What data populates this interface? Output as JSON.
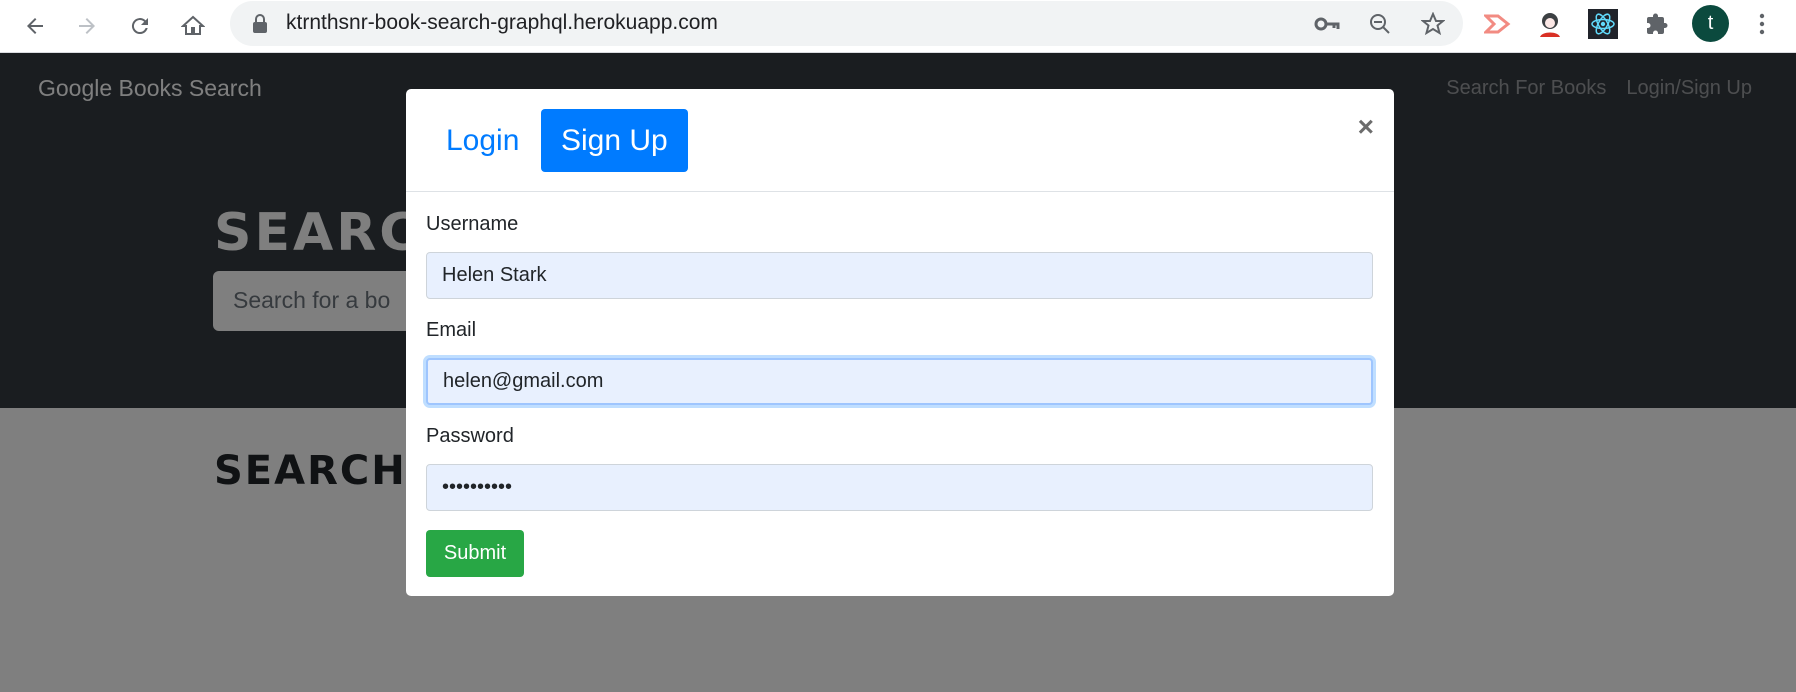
{
  "browser": {
    "url": "ktrnthsnr-book-search-graphql.herokuapp.com",
    "profile_initial": "t",
    "icons": [
      "back-arrow-icon",
      "forward-arrow-icon",
      "reload-icon",
      "home-icon",
      "lock-icon",
      "key-icon",
      "zoom-out-icon",
      "star-icon",
      "extension-arrow-icon",
      "extension-avatar-icon",
      "react-devtools-icon",
      "puzzle-icon",
      "kebab-menu-icon"
    ]
  },
  "navbar": {
    "brand": "Google Books Search",
    "links": [
      "Search For Books",
      "Login/Sign Up"
    ]
  },
  "hero": {
    "title": "SEARC",
    "search_placeholder": "Search for a bo"
  },
  "content": {
    "title": "SEARCH"
  },
  "modal": {
    "tabs": [
      "Login",
      "Sign Up"
    ],
    "active_tab": "Sign Up",
    "close_label": "×",
    "fields": [
      {
        "label": "Username",
        "value": "Helen Stark"
      },
      {
        "label": "Email",
        "value": "helen@gmail.com"
      },
      {
        "label": "Password",
        "value": "••••••••••"
      }
    ],
    "submit_label": "Submit"
  },
  "colors": {
    "primary": "#007bff",
    "success": "#28a745",
    "navbar_bg": "#343a40",
    "input_autofill": "#e8f0fe"
  }
}
